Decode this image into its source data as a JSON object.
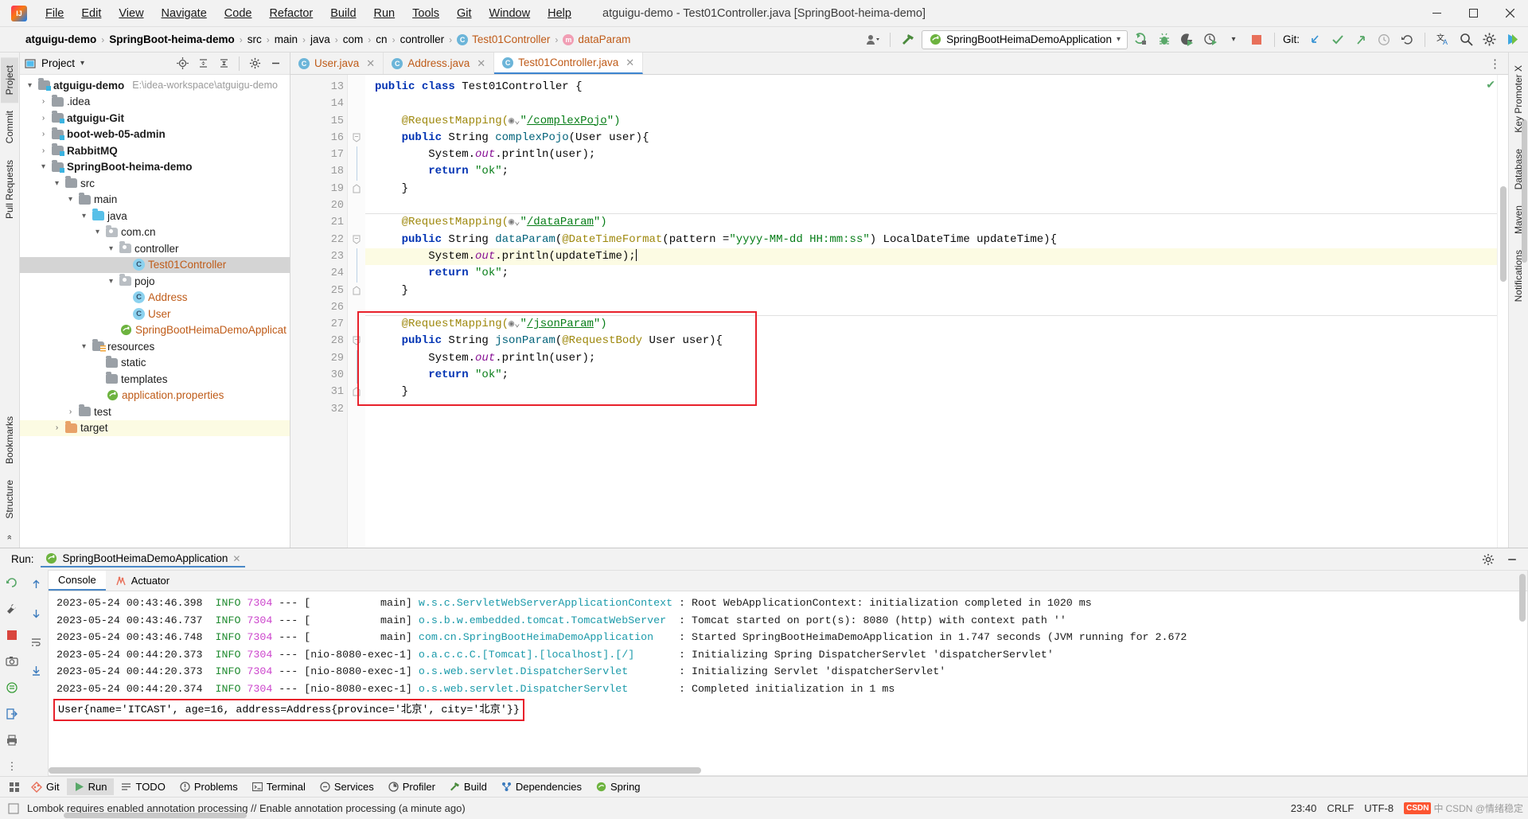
{
  "window": {
    "title": "atguigu-demo - Test01Controller.java [SpringBoot-heima-demo]",
    "minimize": "–",
    "maximize": "□",
    "close": "✕"
  },
  "menubar": [
    {
      "label": "File"
    },
    {
      "label": "Edit"
    },
    {
      "label": "View"
    },
    {
      "label": "Navigate"
    },
    {
      "label": "Code"
    },
    {
      "label": "Refactor"
    },
    {
      "label": "Build"
    },
    {
      "label": "Run"
    },
    {
      "label": "Tools"
    },
    {
      "label": "Git"
    },
    {
      "label": "Window"
    },
    {
      "label": "Help"
    }
  ],
  "navbar": {
    "breadcrumbs": [
      {
        "label": "atguigu-demo",
        "bold": true
      },
      {
        "label": "SpringBoot-heima-demo",
        "bold": true
      },
      {
        "label": "src"
      },
      {
        "label": "main"
      },
      {
        "label": "java"
      },
      {
        "label": "com"
      },
      {
        "label": "cn"
      },
      {
        "label": "controller"
      },
      {
        "label": "Test01Controller",
        "icon": "class-icon"
      },
      {
        "label": "dataParam",
        "icon": "method-icon"
      }
    ],
    "separator": "›",
    "run_config": "SpringBootHeimaDemoApplication",
    "run_config_caret": "▾",
    "git_label": "Git:"
  },
  "project_panel": {
    "title": "Project",
    "caret": "▾",
    "tree": [
      {
        "label": "atguigu-demo",
        "path": "E:\\idea-workspace\\atguigu-demo",
        "indent": 0,
        "twisty": "▾",
        "icon": "module-folder-icon",
        "bold": true
      },
      {
        "label": ".idea",
        "indent": 1,
        "twisty": "›",
        "icon": "folder-icon"
      },
      {
        "label": "atguigu-Git",
        "indent": 1,
        "twisty": "›",
        "icon": "module-folder-icon",
        "bold": true
      },
      {
        "label": "boot-web-05-admin",
        "indent": 1,
        "twisty": "›",
        "icon": "module-folder-icon",
        "bold": true
      },
      {
        "label": "RabbitMQ",
        "indent": 1,
        "twisty": "›",
        "icon": "module-folder-icon",
        "bold": true
      },
      {
        "label": "SpringBoot-heima-demo",
        "indent": 1,
        "twisty": "▾",
        "icon": "module-folder-icon",
        "bold": true
      },
      {
        "label": "src",
        "indent": 2,
        "twisty": "▾",
        "icon": "folder-icon"
      },
      {
        "label": "main",
        "indent": 3,
        "twisty": "▾",
        "icon": "folder-icon"
      },
      {
        "label": "java",
        "indent": 4,
        "twisty": "▾",
        "icon": "source-folder-icon"
      },
      {
        "label": "com.cn",
        "indent": 5,
        "twisty": "▾",
        "icon": "package-icon"
      },
      {
        "label": "controller",
        "indent": 6,
        "twisty": "▾",
        "icon": "package-icon"
      },
      {
        "label": "Test01Controller",
        "indent": 7,
        "twisty": "",
        "icon": "class-icon",
        "selected": true,
        "orange": true
      },
      {
        "label": "pojo",
        "indent": 6,
        "twisty": "▾",
        "icon": "package-icon"
      },
      {
        "label": "Address",
        "indent": 7,
        "twisty": "",
        "icon": "class-icon",
        "orange": true
      },
      {
        "label": "User",
        "indent": 7,
        "twisty": "",
        "icon": "class-icon",
        "orange": true
      },
      {
        "label": "SpringBootHeimaDemoApplicat",
        "indent": 6,
        "twisty": "",
        "icon": "spring-boot-icon",
        "orange": true
      },
      {
        "label": "resources",
        "indent": 4,
        "twisty": "▾",
        "icon": "resource-folder-icon"
      },
      {
        "label": "static",
        "indent": 5,
        "twisty": "",
        "icon": "folder-icon"
      },
      {
        "label": "templates",
        "indent": 5,
        "twisty": "",
        "icon": "folder-icon"
      },
      {
        "label": "application.properties",
        "indent": 5,
        "twisty": "",
        "icon": "spring-properties-icon",
        "orange": true
      },
      {
        "label": "test",
        "indent": 3,
        "twisty": "›",
        "icon": "folder-icon"
      },
      {
        "label": "target",
        "indent": 2,
        "twisty": "›",
        "icon": "excluded-folder-icon",
        "highlighted": true
      }
    ]
  },
  "left_strip": [
    {
      "label": "Project",
      "active": true
    },
    {
      "label": "Commit"
    },
    {
      "label": "Pull Requests"
    }
  ],
  "left_strip_bottom": [
    {
      "label": "Bookmarks"
    },
    {
      "label": "Structure"
    }
  ],
  "right_strip": [
    {
      "label": "Key Promoter X"
    },
    {
      "label": "Database"
    },
    {
      "label": "Maven"
    },
    {
      "label": "Notifications"
    }
  ],
  "editor": {
    "tabs": [
      {
        "label": "User.java",
        "active": false,
        "close": "✕"
      },
      {
        "label": "Address.java",
        "active": false,
        "close": "✕"
      },
      {
        "label": "Test01Controller.java",
        "active": true,
        "close": "✕"
      }
    ],
    "first_line_number": 13,
    "lines": [
      {
        "num": 13,
        "tokens": [
          {
            "t": "public ",
            "c": "kw"
          },
          {
            "t": "class ",
            "c": "kw"
          },
          {
            "t": "Test01Controller ",
            "c": "plain"
          },
          {
            "t": "{",
            "c": "plain"
          }
        ],
        "run_marker": true
      },
      {
        "num": 14,
        "tokens": []
      },
      {
        "num": 15,
        "tokens": [
          {
            "t": "    @RequestMapping(",
            "c": "ann"
          },
          {
            "t": "◉⌄",
            "c": "gutter-glyph"
          },
          {
            "t": "\"",
            "c": "str"
          },
          {
            "t": "/complexPojo",
            "c": "urlstr"
          },
          {
            "t": "\")",
            "c": "str"
          }
        ]
      },
      {
        "num": 16,
        "tokens": [
          {
            "t": "    public ",
            "c": "kw"
          },
          {
            "t": "String ",
            "c": "plain"
          },
          {
            "t": "complexPojo",
            "c": "mth"
          },
          {
            "t": "(User user){",
            "c": "plain"
          }
        ],
        "run_marker": true
      },
      {
        "num": 17,
        "tokens": [
          {
            "t": "        System.",
            "c": "plain"
          },
          {
            "t": "out",
            "c": "fld"
          },
          {
            "t": ".println(user);",
            "c": "plain"
          }
        ]
      },
      {
        "num": 18,
        "tokens": [
          {
            "t": "        return ",
            "c": "kw"
          },
          {
            "t": "\"ok\"",
            "c": "str"
          },
          {
            "t": ";",
            "c": "plain"
          }
        ]
      },
      {
        "num": 19,
        "tokens": [
          {
            "t": "    }",
            "c": "plain"
          }
        ]
      },
      {
        "num": 20,
        "tokens": []
      },
      {
        "num": 21,
        "tokens": [
          {
            "t": "    @RequestMapping(",
            "c": "ann"
          },
          {
            "t": "◉⌄",
            "c": "gutter-glyph"
          },
          {
            "t": "\"",
            "c": "str"
          },
          {
            "t": "/dataParam",
            "c": "urlstr"
          },
          {
            "t": "\")",
            "c": "str"
          }
        ]
      },
      {
        "num": 22,
        "tokens": [
          {
            "t": "    public ",
            "c": "kw"
          },
          {
            "t": "String ",
            "c": "plain"
          },
          {
            "t": "dataParam",
            "c": "mth"
          },
          {
            "t": "(",
            "c": "plain"
          },
          {
            "t": "@DateTimeFormat",
            "c": "ann"
          },
          {
            "t": "(pattern =",
            "c": "plain"
          },
          {
            "t": "\"yyyy-MM-dd HH:mm:ss\"",
            "c": "str"
          },
          {
            "t": ") LocalDateTime updateTime){",
            "c": "plain"
          }
        ],
        "run_marker": true
      },
      {
        "num": 23,
        "tokens": [
          {
            "t": "        System.",
            "c": "plain"
          },
          {
            "t": "out",
            "c": "fld"
          },
          {
            "t": ".println(updateTime);",
            "c": "plain"
          }
        ],
        "current": true
      },
      {
        "num": 24,
        "tokens": [
          {
            "t": "        return ",
            "c": "kw"
          },
          {
            "t": "\"ok\"",
            "c": "str"
          },
          {
            "t": ";",
            "c": "plain"
          }
        ]
      },
      {
        "num": 25,
        "tokens": [
          {
            "t": "    }",
            "c": "plain"
          }
        ]
      },
      {
        "num": 26,
        "tokens": []
      },
      {
        "num": 27,
        "tokens": [
          {
            "t": "    @RequestMapping(",
            "c": "ann"
          },
          {
            "t": "◉⌄",
            "c": "gutter-glyph"
          },
          {
            "t": "\"",
            "c": "str"
          },
          {
            "t": "/jsonParam",
            "c": "urlstr"
          },
          {
            "t": "\")",
            "c": "str"
          }
        ]
      },
      {
        "num": 28,
        "tokens": [
          {
            "t": "    public ",
            "c": "kw"
          },
          {
            "t": "String ",
            "c": "plain"
          },
          {
            "t": "jsonParam",
            "c": "mth"
          },
          {
            "t": "(",
            "c": "plain"
          },
          {
            "t": "@RequestBody",
            "c": "ann"
          },
          {
            "t": " User user){",
            "c": "plain"
          }
        ],
        "run_marker": true
      },
      {
        "num": 29,
        "tokens": [
          {
            "t": "        System.",
            "c": "plain"
          },
          {
            "t": "out",
            "c": "fld"
          },
          {
            "t": ".println(user);",
            "c": "plain"
          }
        ]
      },
      {
        "num": 30,
        "tokens": [
          {
            "t": "        return ",
            "c": "kw"
          },
          {
            "t": "\"ok\"",
            "c": "str"
          },
          {
            "t": ";",
            "c": "plain"
          }
        ]
      },
      {
        "num": 31,
        "tokens": [
          {
            "t": "    }",
            "c": "plain"
          }
        ]
      },
      {
        "num": 32,
        "tokens": []
      }
    ]
  },
  "run_panel": {
    "label": "Run:",
    "config_name": "SpringBootHeimaDemoApplication",
    "close": "✕",
    "tabs": [
      {
        "label": "Console",
        "active": true
      },
      {
        "label": "Actuator",
        "active": false
      }
    ],
    "console_lines": [
      {
        "time": "2023-05-24 00:43:46.398",
        "level": "INFO",
        "pid": "7304",
        "dash": "---",
        "thread": "[           main]",
        "logger": "w.s.c.ServletWebServerApplicationContext",
        "msg": ": Root WebApplicationContext: initialization completed in 1020 ms"
      },
      {
        "time": "2023-05-24 00:43:46.737",
        "level": "INFO",
        "pid": "7304",
        "dash": "---",
        "thread": "[           main]",
        "logger": "o.s.b.w.embedded.tomcat.TomcatWebServer ",
        "msg": ": Tomcat started on port(s): 8080 (http) with context path ''"
      },
      {
        "time": "2023-05-24 00:43:46.748",
        "level": "INFO",
        "pid": "7304",
        "dash": "---",
        "thread": "[           main]",
        "logger": "com.cn.SpringBootHeimaDemoApplication   ",
        "msg": ": Started SpringBootHeimaDemoApplication in 1.747 seconds (JVM running for 2.672"
      },
      {
        "time": "2023-05-24 00:44:20.373",
        "level": "INFO",
        "pid": "7304",
        "dash": "---",
        "thread": "[nio-8080-exec-1]",
        "logger": "o.a.c.c.C.[Tomcat].[localhost].[/]      ",
        "msg": ": Initializing Spring DispatcherServlet 'dispatcherServlet'"
      },
      {
        "time": "2023-05-24 00:44:20.373",
        "level": "INFO",
        "pid": "7304",
        "dash": "---",
        "thread": "[nio-8080-exec-1]",
        "logger": "o.s.web.servlet.DispatcherServlet       ",
        "msg": ": Initializing Servlet 'dispatcherServlet'"
      },
      {
        "time": "2023-05-24 00:44:20.374",
        "level": "INFO",
        "pid": "7304",
        "dash": "---",
        "thread": "[nio-8080-exec-1]",
        "logger": "o.s.web.servlet.DispatcherServlet       ",
        "msg": ": Completed initialization in 1 ms"
      }
    ],
    "highlighted_output": "User{name='ITCAST', age=16, address=Address{province='北京', city='北京'}}"
  },
  "toolwindow_bar": [
    {
      "label": "Git",
      "icon": "git-icon"
    },
    {
      "label": "Run",
      "icon": "run-icon",
      "active": true
    },
    {
      "label": "TODO",
      "icon": "todo-icon"
    },
    {
      "label": "Problems",
      "icon": "problems-icon"
    },
    {
      "label": "Terminal",
      "icon": "terminal-icon"
    },
    {
      "label": "Services",
      "icon": "services-icon"
    },
    {
      "label": "Profiler",
      "icon": "profiler-icon"
    },
    {
      "label": "Build",
      "icon": "build-icon"
    },
    {
      "label": "Dependencies",
      "icon": "dependencies-icon"
    },
    {
      "label": "Spring",
      "icon": "spring-icon"
    }
  ],
  "statusbar": {
    "message": "Lombok requires enabled annotation processing // Enable annotation processing (a minute ago)",
    "position": "23:40",
    "line_sep": "CRLF",
    "encoding": "UTF-8",
    "watermark": "CSDN @情绪稳定",
    "csdn": "CSDN",
    "ime": "中"
  },
  "colors": {
    "accent_blue": "#3d85d0",
    "run_green": "#59a869",
    "error_red": "#e8212b",
    "orange_text": "#bf5b18",
    "keyword_blue": "#0033b3",
    "string_green": "#067d17",
    "annotation_gold": "#9e880d",
    "logger_cyan": "#1b9aaa",
    "pid_magenta": "#cc44cc"
  }
}
